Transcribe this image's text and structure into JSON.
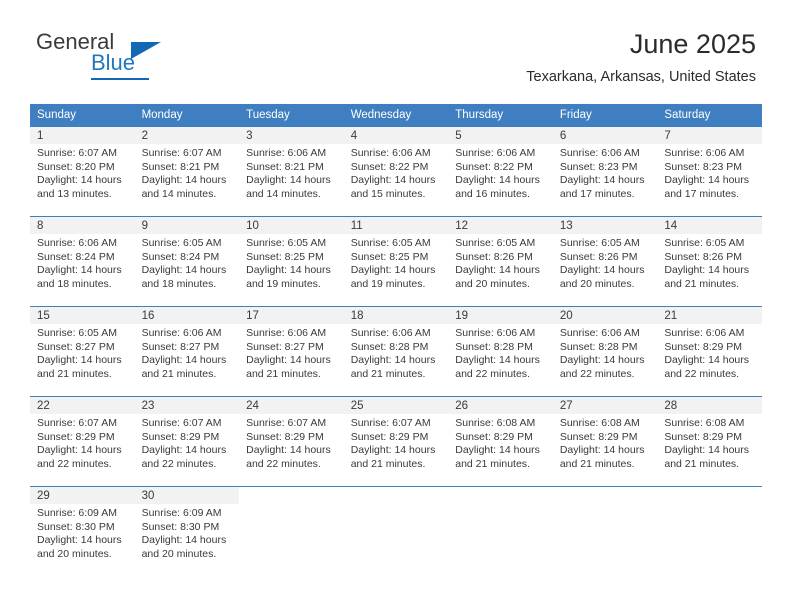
{
  "branding": {
    "name_part1": "General",
    "name_part2": "Blue"
  },
  "header": {
    "month_title": "June 2025",
    "location": "Texarkana, Arkansas, United States"
  },
  "calendar": {
    "weekday_headers": [
      "Sunday",
      "Monday",
      "Tuesday",
      "Wednesday",
      "Thursday",
      "Friday",
      "Saturday"
    ],
    "colors": {
      "header_blue": "#3f7fc1",
      "daynum_band": "#f2f2f2",
      "text": "#3a3a3a",
      "logo_blue": "#1268b3"
    },
    "weeks": [
      [
        {
          "day": "1",
          "sunrise": "Sunrise: 6:07 AM",
          "sunset": "Sunset: 8:20 PM",
          "daylight_line1": "Daylight: 14 hours",
          "daylight_line2": "and 13 minutes."
        },
        {
          "day": "2",
          "sunrise": "Sunrise: 6:07 AM",
          "sunset": "Sunset: 8:21 PM",
          "daylight_line1": "Daylight: 14 hours",
          "daylight_line2": "and 14 minutes."
        },
        {
          "day": "3",
          "sunrise": "Sunrise: 6:06 AM",
          "sunset": "Sunset: 8:21 PM",
          "daylight_line1": "Daylight: 14 hours",
          "daylight_line2": "and 14 minutes."
        },
        {
          "day": "4",
          "sunrise": "Sunrise: 6:06 AM",
          "sunset": "Sunset: 8:22 PM",
          "daylight_line1": "Daylight: 14 hours",
          "daylight_line2": "and 15 minutes."
        },
        {
          "day": "5",
          "sunrise": "Sunrise: 6:06 AM",
          "sunset": "Sunset: 8:22 PM",
          "daylight_line1": "Daylight: 14 hours",
          "daylight_line2": "and 16 minutes."
        },
        {
          "day": "6",
          "sunrise": "Sunrise: 6:06 AM",
          "sunset": "Sunset: 8:23 PM",
          "daylight_line1": "Daylight: 14 hours",
          "daylight_line2": "and 17 minutes."
        },
        {
          "day": "7",
          "sunrise": "Sunrise: 6:06 AM",
          "sunset": "Sunset: 8:23 PM",
          "daylight_line1": "Daylight: 14 hours",
          "daylight_line2": "and 17 minutes."
        }
      ],
      [
        {
          "day": "8",
          "sunrise": "Sunrise: 6:06 AM",
          "sunset": "Sunset: 8:24 PM",
          "daylight_line1": "Daylight: 14 hours",
          "daylight_line2": "and 18 minutes."
        },
        {
          "day": "9",
          "sunrise": "Sunrise: 6:05 AM",
          "sunset": "Sunset: 8:24 PM",
          "daylight_line1": "Daylight: 14 hours",
          "daylight_line2": "and 18 minutes."
        },
        {
          "day": "10",
          "sunrise": "Sunrise: 6:05 AM",
          "sunset": "Sunset: 8:25 PM",
          "daylight_line1": "Daylight: 14 hours",
          "daylight_line2": "and 19 minutes."
        },
        {
          "day": "11",
          "sunrise": "Sunrise: 6:05 AM",
          "sunset": "Sunset: 8:25 PM",
          "daylight_line1": "Daylight: 14 hours",
          "daylight_line2": "and 19 minutes."
        },
        {
          "day": "12",
          "sunrise": "Sunrise: 6:05 AM",
          "sunset": "Sunset: 8:26 PM",
          "daylight_line1": "Daylight: 14 hours",
          "daylight_line2": "and 20 minutes."
        },
        {
          "day": "13",
          "sunrise": "Sunrise: 6:05 AM",
          "sunset": "Sunset: 8:26 PM",
          "daylight_line1": "Daylight: 14 hours",
          "daylight_line2": "and 20 minutes."
        },
        {
          "day": "14",
          "sunrise": "Sunrise: 6:05 AM",
          "sunset": "Sunset: 8:26 PM",
          "daylight_line1": "Daylight: 14 hours",
          "daylight_line2": "and 21 minutes."
        }
      ],
      [
        {
          "day": "15",
          "sunrise": "Sunrise: 6:05 AM",
          "sunset": "Sunset: 8:27 PM",
          "daylight_line1": "Daylight: 14 hours",
          "daylight_line2": "and 21 minutes."
        },
        {
          "day": "16",
          "sunrise": "Sunrise: 6:06 AM",
          "sunset": "Sunset: 8:27 PM",
          "daylight_line1": "Daylight: 14 hours",
          "daylight_line2": "and 21 minutes."
        },
        {
          "day": "17",
          "sunrise": "Sunrise: 6:06 AM",
          "sunset": "Sunset: 8:27 PM",
          "daylight_line1": "Daylight: 14 hours",
          "daylight_line2": "and 21 minutes."
        },
        {
          "day": "18",
          "sunrise": "Sunrise: 6:06 AM",
          "sunset": "Sunset: 8:28 PM",
          "daylight_line1": "Daylight: 14 hours",
          "daylight_line2": "and 21 minutes."
        },
        {
          "day": "19",
          "sunrise": "Sunrise: 6:06 AM",
          "sunset": "Sunset: 8:28 PM",
          "daylight_line1": "Daylight: 14 hours",
          "daylight_line2": "and 22 minutes."
        },
        {
          "day": "20",
          "sunrise": "Sunrise: 6:06 AM",
          "sunset": "Sunset: 8:28 PM",
          "daylight_line1": "Daylight: 14 hours",
          "daylight_line2": "and 22 minutes."
        },
        {
          "day": "21",
          "sunrise": "Sunrise: 6:06 AM",
          "sunset": "Sunset: 8:29 PM",
          "daylight_line1": "Daylight: 14 hours",
          "daylight_line2": "and 22 minutes."
        }
      ],
      [
        {
          "day": "22",
          "sunrise": "Sunrise: 6:07 AM",
          "sunset": "Sunset: 8:29 PM",
          "daylight_line1": "Daylight: 14 hours",
          "daylight_line2": "and 22 minutes."
        },
        {
          "day": "23",
          "sunrise": "Sunrise: 6:07 AM",
          "sunset": "Sunset: 8:29 PM",
          "daylight_line1": "Daylight: 14 hours",
          "daylight_line2": "and 22 minutes."
        },
        {
          "day": "24",
          "sunrise": "Sunrise: 6:07 AM",
          "sunset": "Sunset: 8:29 PM",
          "daylight_line1": "Daylight: 14 hours",
          "daylight_line2": "and 22 minutes."
        },
        {
          "day": "25",
          "sunrise": "Sunrise: 6:07 AM",
          "sunset": "Sunset: 8:29 PM",
          "daylight_line1": "Daylight: 14 hours",
          "daylight_line2": "and 21 minutes."
        },
        {
          "day": "26",
          "sunrise": "Sunrise: 6:08 AM",
          "sunset": "Sunset: 8:29 PM",
          "daylight_line1": "Daylight: 14 hours",
          "daylight_line2": "and 21 minutes."
        },
        {
          "day": "27",
          "sunrise": "Sunrise: 6:08 AM",
          "sunset": "Sunset: 8:29 PM",
          "daylight_line1": "Daylight: 14 hours",
          "daylight_line2": "and 21 minutes."
        },
        {
          "day": "28",
          "sunrise": "Sunrise: 6:08 AM",
          "sunset": "Sunset: 8:29 PM",
          "daylight_line1": "Daylight: 14 hours",
          "daylight_line2": "and 21 minutes."
        }
      ],
      [
        {
          "day": "29",
          "sunrise": "Sunrise: 6:09 AM",
          "sunset": "Sunset: 8:30 PM",
          "daylight_line1": "Daylight: 14 hours",
          "daylight_line2": "and 20 minutes."
        },
        {
          "day": "30",
          "sunrise": "Sunrise: 6:09 AM",
          "sunset": "Sunset: 8:30 PM",
          "daylight_line1": "Daylight: 14 hours",
          "daylight_line2": "and 20 minutes."
        },
        null,
        null,
        null,
        null,
        null
      ]
    ]
  }
}
